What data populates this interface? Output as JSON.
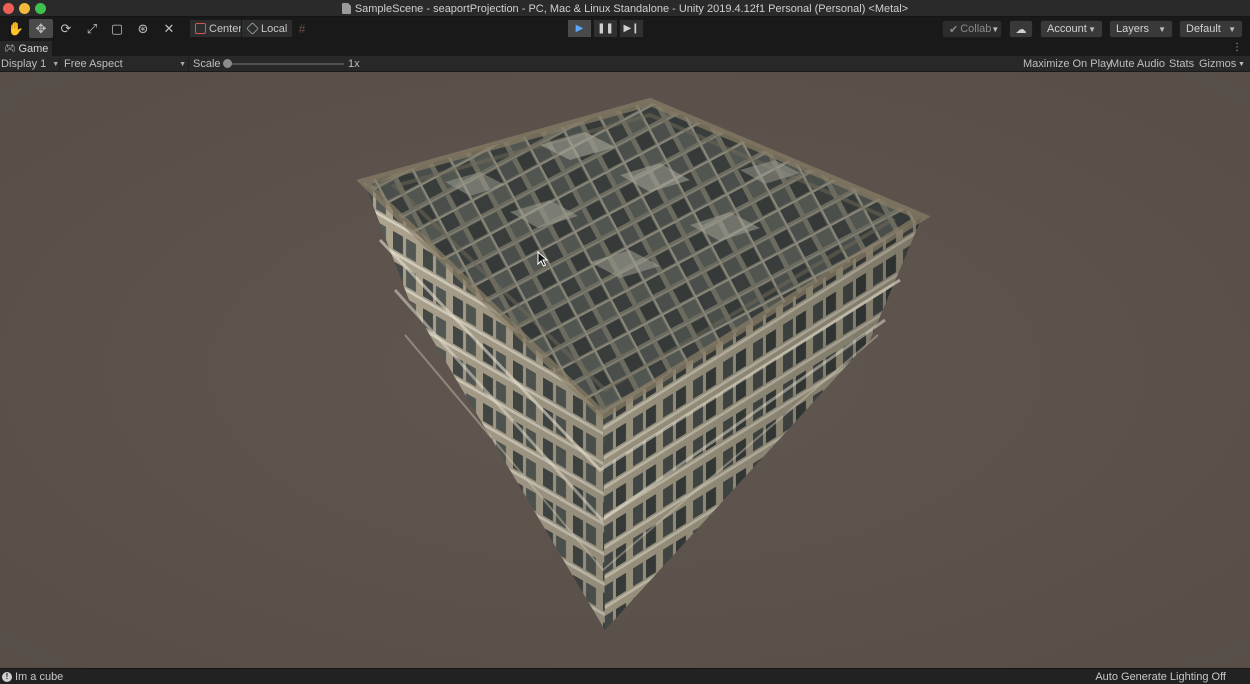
{
  "window": {
    "title": "SampleScene - seaportProjection - PC, Mac & Linux Standalone - Unity 2019.4.12f1 Personal (Personal) <Metal>"
  },
  "toolbar": {
    "tools": [
      {
        "name": "hand-tool",
        "icon": "✋"
      },
      {
        "name": "move-tool",
        "icon": "✥"
      },
      {
        "name": "rotate-tool",
        "icon": "⟳"
      },
      {
        "name": "scale-tool",
        "icon": "⤢"
      },
      {
        "name": "rect-tool",
        "icon": "▢"
      },
      {
        "name": "transform-tool",
        "icon": "⊛"
      },
      {
        "name": "custom-tool",
        "icon": "✕"
      }
    ],
    "pivot_mode": "Center",
    "pivot_rotation": "Local",
    "collab": "Collab",
    "account": "Account",
    "layers": "Layers",
    "layout": "Default"
  },
  "game_tab": {
    "label": "Game"
  },
  "game_bar": {
    "display": "Display 1",
    "aspect": "Free Aspect",
    "scale_label": "Scale",
    "scale_value": "1x",
    "maximize_on_play": "Maximize On Play",
    "mute_audio": "Mute Audio",
    "stats": "Stats",
    "gizmos": "Gizmos"
  },
  "status": {
    "message": "Im a cube",
    "lighting": "Auto Generate Lighting Off"
  },
  "colors": {
    "play_active": "#5aa7ff",
    "background": "#5b524b"
  }
}
